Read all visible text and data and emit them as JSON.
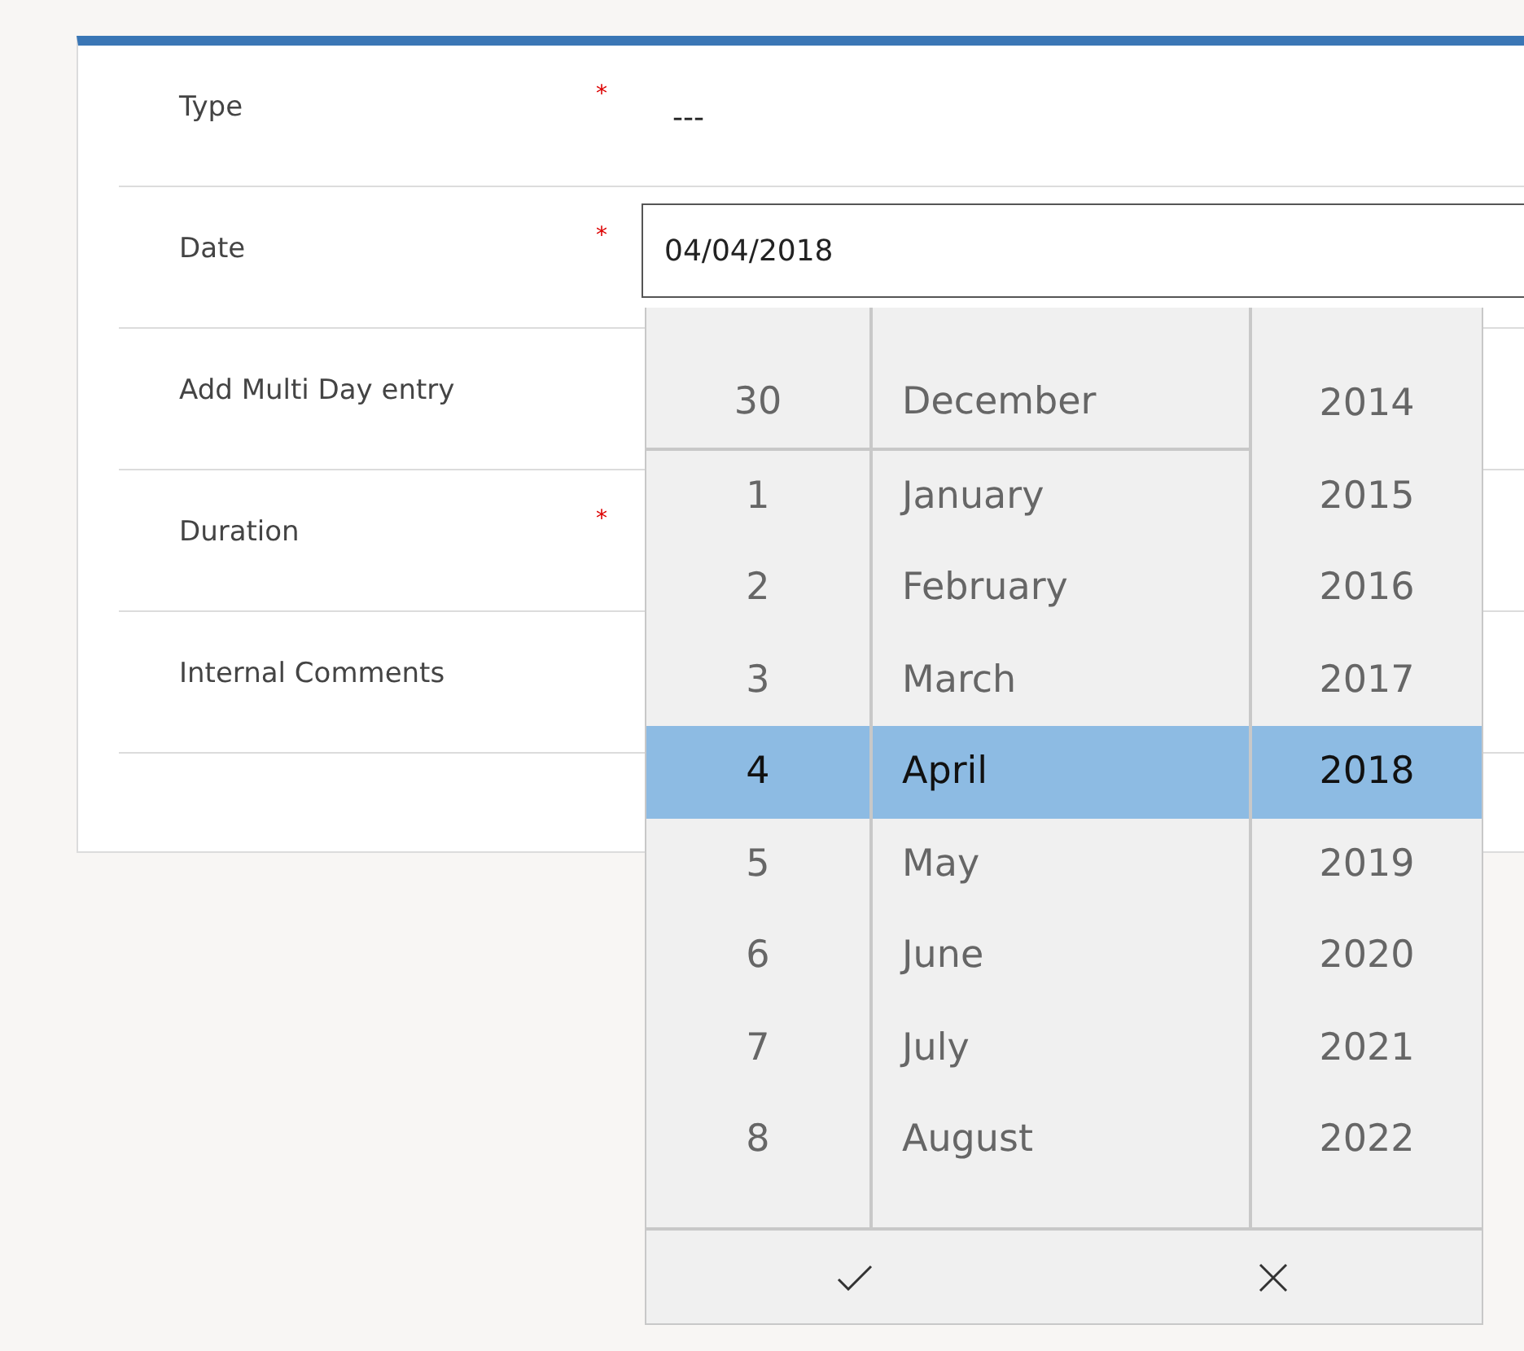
{
  "fields": [
    {
      "label": "Type",
      "required_mark": "*",
      "kind": "text",
      "value": "---"
    },
    {
      "label": "Date",
      "required_mark": "*",
      "kind": "input",
      "value": "04/04/2018"
    },
    {
      "label": "Add Multi Day entry",
      "kind": "empty"
    },
    {
      "label": "Duration",
      "required_mark": "*",
      "kind": "empty"
    },
    {
      "label": "Internal Comments",
      "kind": "empty"
    }
  ],
  "picker": {
    "columns": [
      {
        "kind": "day",
        "items": [
          {
            "text": "30",
            "selected": false,
            "wrap": true
          },
          {
            "text": "1",
            "selected": false,
            "wrap": false
          },
          {
            "text": "2",
            "selected": false,
            "wrap": false
          },
          {
            "text": "3",
            "selected": false,
            "wrap": false
          },
          {
            "text": "4",
            "selected": true,
            "wrap": false
          },
          {
            "text": "5",
            "selected": false,
            "wrap": false
          },
          {
            "text": "6",
            "selected": false,
            "wrap": false
          },
          {
            "text": "7",
            "selected": false,
            "wrap": false
          },
          {
            "text": "8",
            "selected": false,
            "wrap": false
          }
        ]
      },
      {
        "kind": "month",
        "items": [
          {
            "text": "December",
            "selected": false,
            "wrap": true
          },
          {
            "text": "January",
            "selected": false,
            "wrap": false
          },
          {
            "text": "February",
            "selected": false,
            "wrap": false
          },
          {
            "text": "March",
            "selected": false,
            "wrap": false
          },
          {
            "text": "April",
            "selected": true,
            "wrap": false
          },
          {
            "text": "May",
            "selected": false,
            "wrap": false
          },
          {
            "text": "June",
            "selected": false,
            "wrap": false
          },
          {
            "text": "July",
            "selected": false,
            "wrap": false
          },
          {
            "text": "August",
            "selected": false,
            "wrap": false
          }
        ]
      },
      {
        "kind": "year",
        "items": [
          {
            "text": "2014",
            "selected": false,
            "wrap": false
          },
          {
            "text": "2015",
            "selected": false,
            "wrap": false
          },
          {
            "text": "2016",
            "selected": false,
            "wrap": false
          },
          {
            "text": "2017",
            "selected": false,
            "wrap": false
          },
          {
            "text": "2018",
            "selected": true,
            "wrap": false
          },
          {
            "text": "2019",
            "selected": false,
            "wrap": false
          },
          {
            "text": "2020",
            "selected": false,
            "wrap": false
          },
          {
            "text": "2021",
            "selected": false,
            "wrap": false
          },
          {
            "text": "2022",
            "selected": false,
            "wrap": false
          }
        ]
      }
    ]
  }
}
